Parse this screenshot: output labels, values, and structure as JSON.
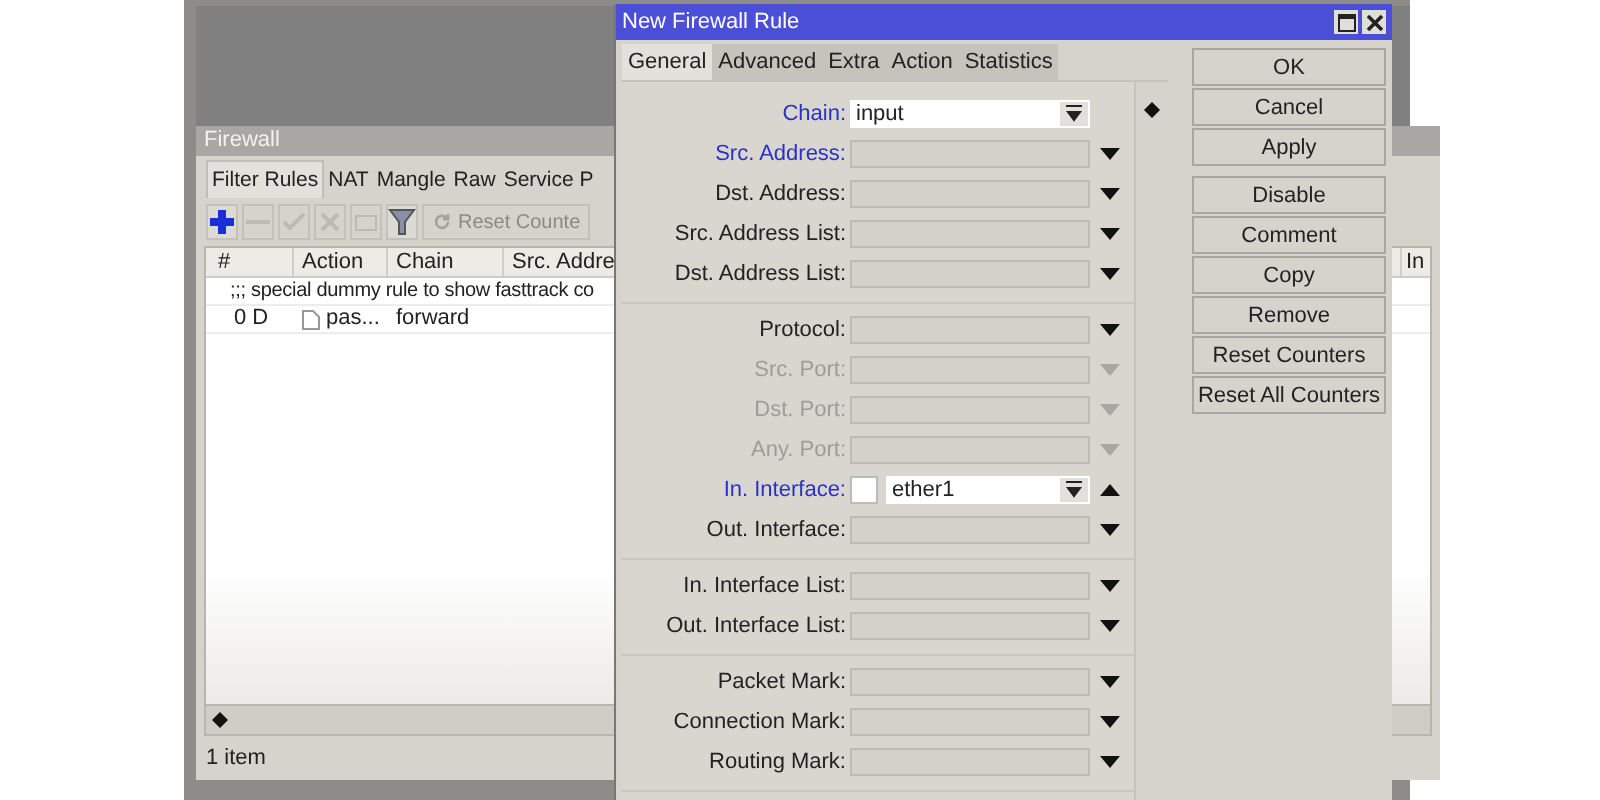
{
  "firewall": {
    "title": "Firewall",
    "tabs": [
      {
        "label": "Filter Rules",
        "selected": true
      },
      {
        "label": "NAT",
        "selected": false
      },
      {
        "label": "Mangle",
        "selected": false
      },
      {
        "label": "Raw",
        "selected": false
      },
      {
        "label": "Service P",
        "selected": false
      }
    ],
    "toolbar": {
      "reset_button": "Reset Counte"
    },
    "table": {
      "columns": [
        "#",
        "Action",
        "Chain",
        "Src. Addre",
        "In"
      ],
      "rows": [
        {
          "kind": "comment",
          "text": ";;; special dummy rule to show fasttrack co"
        },
        {
          "kind": "rule",
          "number": "0 D",
          "action": "pas...",
          "chain": "forward"
        }
      ]
    },
    "status_bar": "1 item"
  },
  "dialog": {
    "title": "New Firewall Rule",
    "tabs": [
      {
        "label": "General",
        "selected": true
      },
      {
        "label": "Advanced",
        "selected": false
      },
      {
        "label": "Extra",
        "selected": false
      },
      {
        "label": "Action",
        "selected": false
      },
      {
        "label": "Statistics",
        "selected": false
      }
    ],
    "groups": [
      [
        {
          "label": "Chain:",
          "kind": "combo",
          "value": "input",
          "active": true,
          "disabled": false
        },
        {
          "label": "Src. Address:",
          "kind": "dropdown",
          "active": true,
          "disabled": false,
          "expanded": false
        },
        {
          "label": "Dst. Address:",
          "kind": "dropdown",
          "active": false,
          "disabled": false,
          "expanded": false
        },
        {
          "label": "Src. Address List:",
          "kind": "dropdown",
          "active": false,
          "disabled": false,
          "expanded": false
        },
        {
          "label": "Dst. Address List:",
          "kind": "dropdown",
          "active": false,
          "disabled": false,
          "expanded": false
        }
      ],
      [
        {
          "label": "Protocol:",
          "kind": "dropdown",
          "active": false,
          "disabled": false,
          "expanded": false
        },
        {
          "label": "Src. Port:",
          "kind": "dropdown",
          "active": false,
          "disabled": true,
          "expanded": false
        },
        {
          "label": "Dst. Port:",
          "kind": "dropdown",
          "active": false,
          "disabled": true,
          "expanded": false
        },
        {
          "label": "Any. Port:",
          "kind": "dropdown",
          "active": false,
          "disabled": true,
          "expanded": false
        },
        {
          "label": "In. Interface:",
          "kind": "interface",
          "value": "ether1",
          "checked": false,
          "active": true,
          "disabled": false,
          "expanded": true
        },
        {
          "label": "Out. Interface:",
          "kind": "dropdown",
          "active": false,
          "disabled": false,
          "expanded": false
        }
      ],
      [
        {
          "label": "In. Interface List:",
          "kind": "dropdown",
          "active": false,
          "disabled": false,
          "expanded": false
        },
        {
          "label": "Out. Interface List:",
          "kind": "dropdown",
          "active": false,
          "disabled": false,
          "expanded": false
        }
      ],
      [
        {
          "label": "Packet Mark:",
          "kind": "dropdown",
          "active": false,
          "disabled": false,
          "expanded": false
        },
        {
          "label": "Connection Mark:",
          "kind": "dropdown",
          "active": false,
          "disabled": false,
          "expanded": false
        },
        {
          "label": "Routing Mark:",
          "kind": "dropdown",
          "active": false,
          "disabled": false,
          "expanded": false
        }
      ]
    ],
    "buttons": [
      [
        "OK",
        "Cancel",
        "Apply"
      ],
      [
        "Disable",
        "Comment",
        "Copy",
        "Remove",
        "Reset Counters",
        "Reset All Counters"
      ]
    ]
  }
}
